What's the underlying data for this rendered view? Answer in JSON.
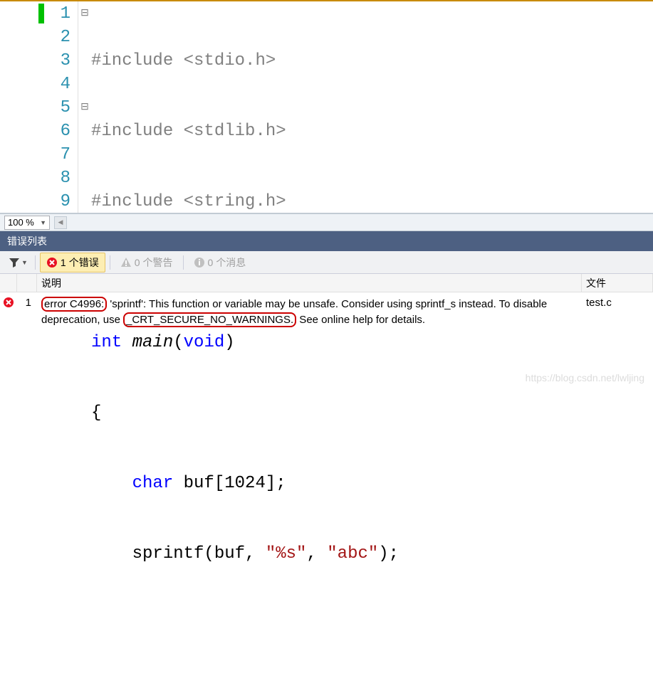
{
  "editor": {
    "lines": [
      "1",
      "2",
      "3",
      "4",
      "5",
      "6",
      "7",
      "8",
      "9"
    ],
    "outline": [
      "⊟",
      "",
      "",
      "",
      "⊟",
      "",
      "",
      "",
      ""
    ],
    "code": {
      "l1": {
        "pp": "#include ",
        "inc": "<stdio.h>"
      },
      "l2": {
        "pp": "#include ",
        "inc": "<stdlib.h>"
      },
      "l3": {
        "pp": "#include ",
        "inc": "<string.h>"
      },
      "l4": "",
      "l5": {
        "kw1": "int",
        "sp": " ",
        "fn": "main",
        "p1": "(",
        "kw2": "void",
        "p2": ")"
      },
      "l6": "{",
      "l7": {
        "indent": "    ",
        "kw": "char",
        "rest": " buf[1024];"
      },
      "l8": {
        "indent": "    ",
        "call": "sprintf(buf, ",
        "s1": "\"%s\"",
        "mid": ", ",
        "s2": "\"abc\"",
        "end": ");"
      },
      "l9": ""
    }
  },
  "zoom": {
    "value": "100 %"
  },
  "panel": {
    "title": "错误列表"
  },
  "toolbar": {
    "errors": {
      "count": "1",
      "label": "个错误"
    },
    "warnings": {
      "count": "0",
      "label": "个警告"
    },
    "messages": {
      "count": "0",
      "label": "个消息"
    }
  },
  "table": {
    "col_desc": "说明",
    "col_file": "文件"
  },
  "error_row": {
    "index": "1",
    "code": "error C4996:",
    "desc_pre": " 'sprintf': This function or variable may be unsafe. Consider using sprintf_s instead. To disable deprecation, use ",
    "macro": "_CRT_SECURE_NO_WARNINGS.",
    "desc_post": " See online help for details.",
    "file": "test.c"
  },
  "watermark": "https://blog.csdn.net/lwljing"
}
